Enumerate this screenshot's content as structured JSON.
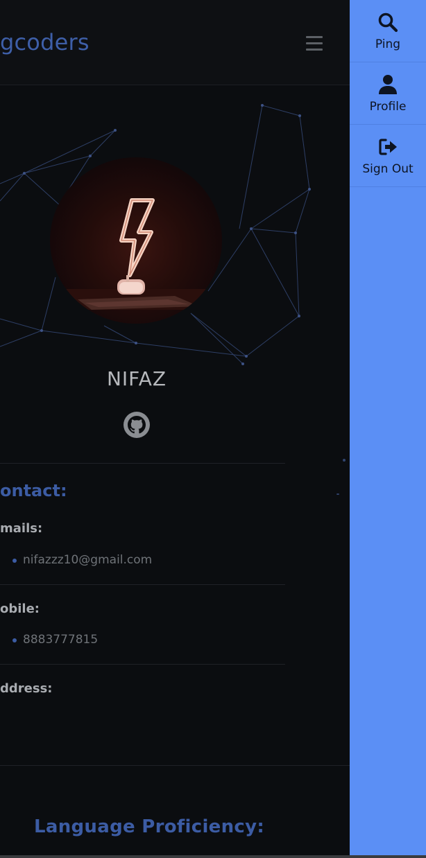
{
  "navbar": {
    "brand": "gcoders"
  },
  "profile": {
    "name": "NIFAZ"
  },
  "contact": {
    "title": "ontact:",
    "emails_label": "mails:",
    "email": "nifazzz10@gmail.com",
    "mobile_label": "obile:",
    "mobile": "8883777815",
    "address_label": "ddress:"
  },
  "language_section": {
    "title": "Language Proficiency:"
  },
  "sidebar": {
    "items": [
      {
        "label": "Ping",
        "icon": "search-icon"
      },
      {
        "label": "Profile",
        "icon": "user-icon"
      },
      {
        "label": "Sign Out",
        "icon": "sign-out-icon"
      }
    ]
  },
  "colors": {
    "sidebar_bg": "#5b8ff5",
    "accent": "#3c5ca4",
    "page_bg": "#0b0d10"
  }
}
